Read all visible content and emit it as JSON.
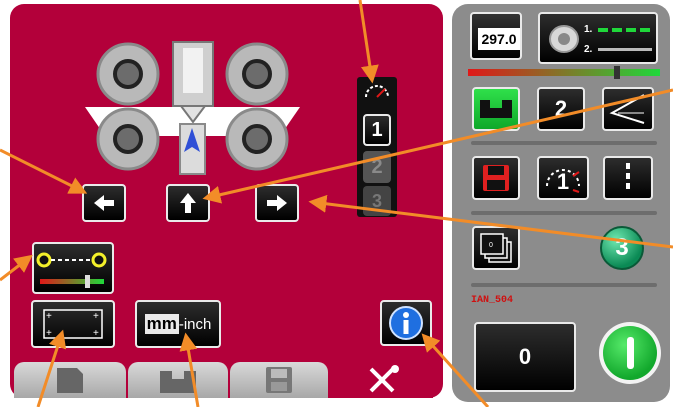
{
  "program": {
    "value_label": "297.0",
    "layer_1_label": "1.",
    "layer_2_label": "2."
  },
  "layer_buttons": [
    "1",
    "2",
    "3"
  ],
  "unit_toggle": {
    "mm_label": "mm",
    "inch_label": "-inch"
  },
  "right_panel": {
    "step_number": "2",
    "step_counter_label": "1",
    "badge_number": "3",
    "status_text": "IAN_504",
    "counter_value": "0"
  },
  "colors": {
    "machine_panel": "#b3003a",
    "control_panel": "#8c8c8c",
    "accent_green": "#1fd83a",
    "accent_orange": "#f28c28",
    "status_red": "#d01010"
  },
  "icons": [
    "machine-rollers-icon",
    "arrow-left-icon",
    "arrow-up-icon",
    "arrow-right-icon",
    "speed-gauge-icon",
    "slider-link-icon",
    "frame-icon",
    "info-icon",
    "page-icon",
    "bend-icon",
    "save-icon",
    "tools-icon",
    "rolls-icon",
    "bend-profile-icon",
    "angle-icon",
    "floppy-icon",
    "counter-icon",
    "dashed-line-icon",
    "stacked-pages-icon",
    "power-icon"
  ]
}
